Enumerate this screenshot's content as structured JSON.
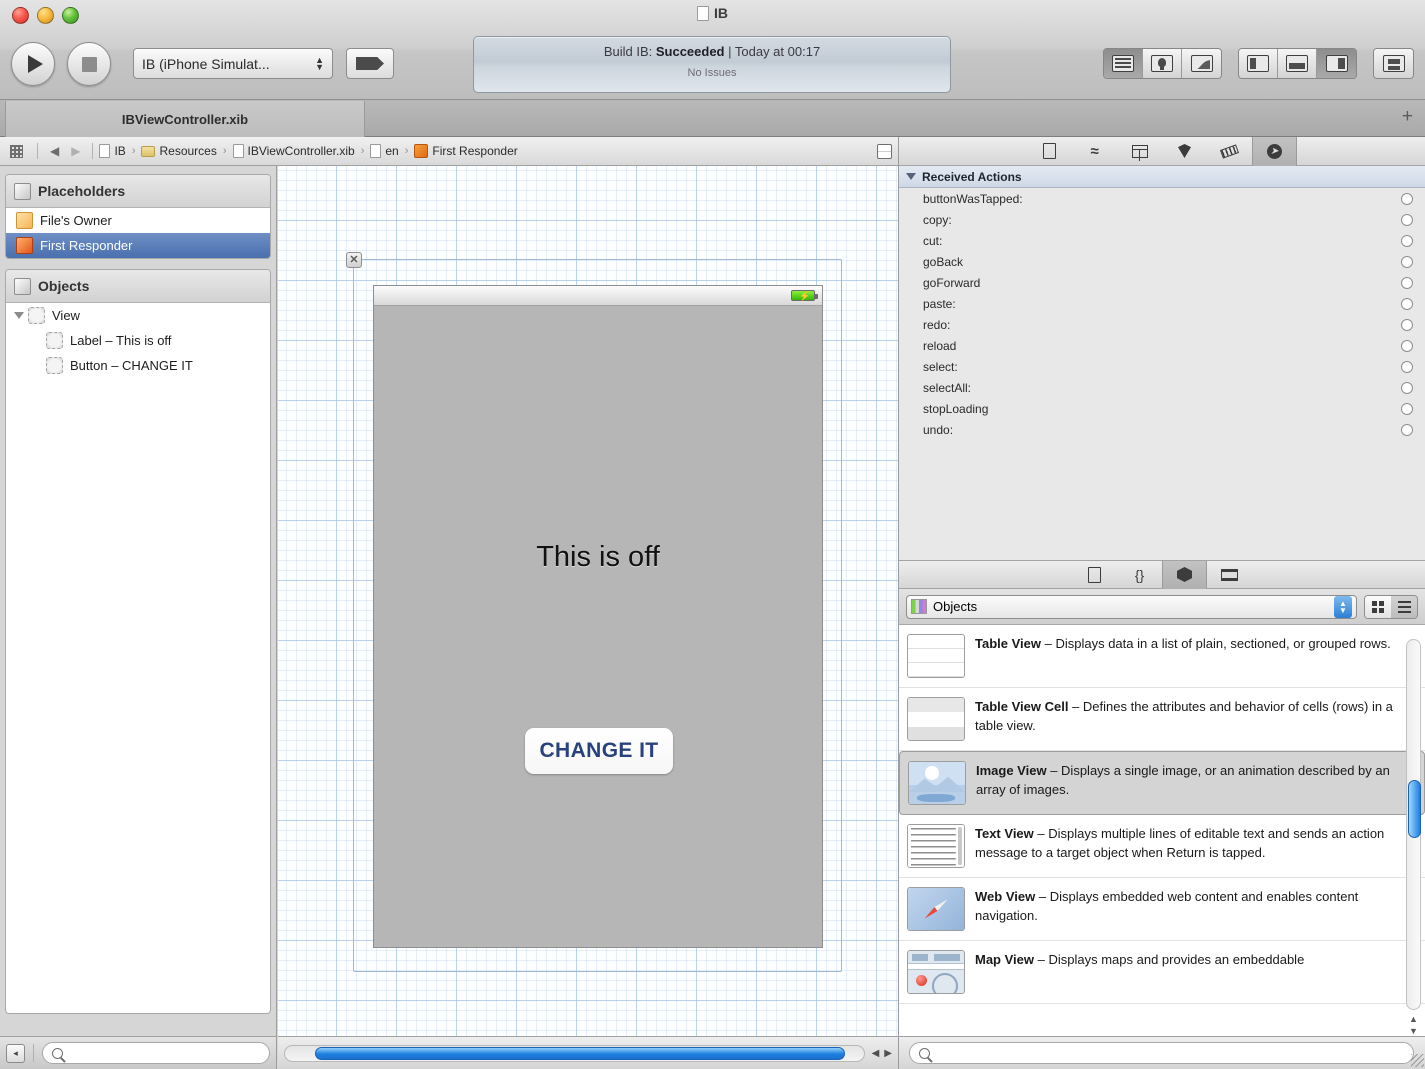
{
  "window": {
    "title": "IB",
    "title_icon": "page-icon",
    "traffic_lights": [
      "close",
      "minimize",
      "zoom"
    ]
  },
  "toolbar": {
    "run_label": "Run",
    "stop_label": "Stop",
    "scheme": "IB (iPhone Simulat...",
    "breakpoint_label": "Breakpoints",
    "activity": {
      "prefix": "Build IB: ",
      "status": "Succeeded",
      "suffix": " | Today at 00:17",
      "issues": "No Issues"
    },
    "view_segments": [
      "navigator-toggle",
      "debug-toggle",
      "assistant-toggle"
    ],
    "editor_segments": [
      "standard-editor",
      "assistant-editor",
      "version-editor"
    ],
    "utility_segment": "utilities-toggle"
  },
  "tabbar": {
    "tabs": [
      {
        "label": "IBViewController.xib",
        "active": true
      }
    ],
    "add_label": "+"
  },
  "jumpbar": {
    "back_label": "◀",
    "forward_label": "▶",
    "crumbs": [
      {
        "label": "IB",
        "icon": "page-icon"
      },
      {
        "label": "Resources",
        "icon": "folder-icon"
      },
      {
        "label": "IBViewController.xib",
        "icon": "page-icon"
      },
      {
        "label": "en",
        "icon": "page-icon"
      },
      {
        "label": "First Responder",
        "icon": "cube-orange-icon"
      }
    ],
    "chevron": "›"
  },
  "navigator": {
    "placeholders": {
      "title": "Placeholders",
      "items": [
        {
          "label": "File's Owner",
          "icon": "cube-yellow-icon",
          "selected": false
        },
        {
          "label": "First Responder",
          "icon": "cube-orange-icon",
          "selected": true
        }
      ]
    },
    "objects": {
      "title": "Objects",
      "items": [
        {
          "label": "View",
          "icon": "view-icon",
          "indent": 0,
          "expanded": true
        },
        {
          "label": "Label – This is off",
          "icon": "view-icon",
          "indent": 1
        },
        {
          "label": "Button – CHANGE IT",
          "icon": "view-icon",
          "indent": 1
        }
      ]
    },
    "footer": {
      "collapse_label": "◂",
      "filter_placeholder": ""
    }
  },
  "canvas": {
    "close_label": "✕",
    "status_bar": {
      "battery": "battery-charging-icon",
      "bolt": "⚡"
    },
    "label_text": "This is off",
    "button_text": "CHANGE IT",
    "hscroll": {
      "left_arrow": "◀",
      "right_arrow": "▶"
    }
  },
  "inspector": {
    "tabs": [
      {
        "name": "file-inspector-tab",
        "selected": false
      },
      {
        "name": "quick-help-tab",
        "selected": false
      },
      {
        "name": "identity-inspector-tab",
        "selected": false
      },
      {
        "name": "attributes-inspector-tab",
        "selected": false
      },
      {
        "name": "size-inspector-tab",
        "selected": false
      },
      {
        "name": "connections-inspector-tab",
        "selected": true
      }
    ],
    "section_title": "Received Actions",
    "actions": [
      "buttonWasTapped:",
      "copy:",
      "cut:",
      "goBack",
      "goForward",
      "paste:",
      "redo:",
      "reload",
      "select:",
      "selectAll:",
      "stopLoading",
      "undo:"
    ]
  },
  "library": {
    "tabs": [
      {
        "name": "file-template-library-tab",
        "selected": false
      },
      {
        "name": "code-snippet-library-tab",
        "selected": false
      },
      {
        "name": "object-library-tab",
        "selected": true
      },
      {
        "name": "media-library-tab",
        "selected": false
      }
    ],
    "popup_label": "Objects",
    "view_modes": [
      {
        "name": "icon-view",
        "selected": false
      },
      {
        "name": "list-view",
        "selected": true
      }
    ],
    "items": [
      {
        "title": "Table View",
        "dash": " – ",
        "desc": "Displays data in a list of plain, sectioned, or grouped rows.",
        "icon": "table-view-icon",
        "selected": false
      },
      {
        "title": "Table View Cell",
        "dash": " – ",
        "desc": "Defines the attributes and behavior of cells (rows) in a table view.",
        "icon": "table-view-cell-icon",
        "selected": false
      },
      {
        "title": "Image View",
        "dash": " – ",
        "desc": "Displays a single image, or an animation described by an array of images.",
        "icon": "image-view-icon",
        "selected": true
      },
      {
        "title": "Text View",
        "dash": " – ",
        "desc": "Displays multiple lines of editable text and sends an action message to a target object when Return is tapped.",
        "icon": "text-view-icon",
        "selected": false
      },
      {
        "title": "Web View",
        "dash": " – ",
        "desc": "Displays embedded web content and enables content navigation.",
        "icon": "web-view-icon",
        "selected": false
      },
      {
        "title": "Map View",
        "dash": " – ",
        "desc": "Displays maps and provides an embeddable",
        "icon": "map-view-icon",
        "selected": false
      }
    ],
    "footer": {
      "filter_placeholder": ""
    }
  },
  "colors": {
    "selection_blue": "#4a6fae",
    "scroll_blue": "#1d7fe0",
    "button_text_blue": "#29417c",
    "battery_green": "#36b50b"
  }
}
